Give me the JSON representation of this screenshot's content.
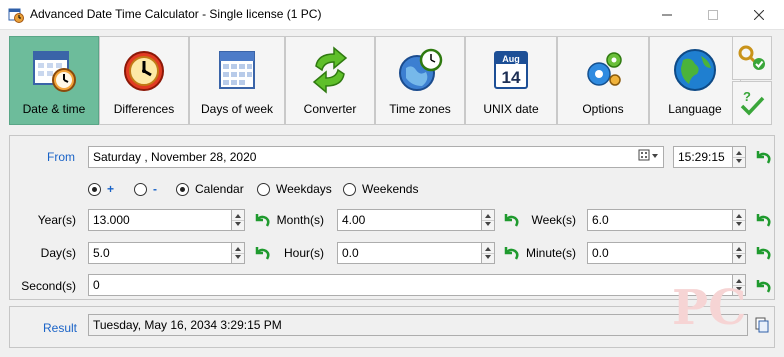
{
  "window": {
    "title": "Advanced Date Time Calculator - Single license (1 PC)",
    "minimize_icon": "minimize-icon",
    "maximize_icon": "maximize-icon",
    "close_icon": "close-icon"
  },
  "toolbar": {
    "items": [
      {
        "label": "Date & time",
        "icon": "calendar-clock-icon",
        "active": true
      },
      {
        "label": "Differences",
        "icon": "alarm-clock-icon",
        "active": false
      },
      {
        "label": "Days of week",
        "icon": "calendar-grid-icon",
        "active": false
      },
      {
        "label": "Converter",
        "icon": "convert-arrows-icon",
        "active": false
      },
      {
        "label": "Time zones",
        "icon": "globe-clock-icon",
        "active": false
      },
      {
        "label": "UNIX date",
        "icon": "calendar-page-icon",
        "active": false
      },
      {
        "label": "Options",
        "icon": "gears-icon",
        "active": false
      },
      {
        "label": "Language",
        "icon": "globe-icon",
        "active": false
      }
    ],
    "calendar_page": {
      "month": "Aug",
      "day": "14"
    },
    "side_buttons": [
      {
        "icon": "license-key-icon"
      },
      {
        "icon": "check-help-icon"
      }
    ]
  },
  "from": {
    "label": "From",
    "date_value": "Saturday   , November 28, 2020",
    "time_value": "15:29:15"
  },
  "operation": {
    "plus_label": "+",
    "minus_label": "-",
    "selected": "plus"
  },
  "mode": {
    "options": [
      "Calendar",
      "Weekdays",
      "Weekends"
    ],
    "selected": "Calendar"
  },
  "fields": {
    "years": {
      "label": "Year(s)",
      "value": "13.000"
    },
    "months": {
      "label": "Month(s)",
      "value": "4.00"
    },
    "weeks": {
      "label": "Week(s)",
      "value": "6.0"
    },
    "days": {
      "label": "Day(s)",
      "value": "5.0"
    },
    "hours": {
      "label": "Hour(s)",
      "value": "0.0"
    },
    "minutes": {
      "label": "Minute(s)",
      "value": "0.0"
    },
    "seconds": {
      "label": "Second(s)",
      "value": "0"
    }
  },
  "result": {
    "label": "Result",
    "value": "Tuesday, May 16, 2034 3:29:15 PM"
  },
  "colors": {
    "accent_blue": "#1a63c7",
    "active_tab": "#6dbc9b",
    "undo_green": "#1f9a2e"
  }
}
